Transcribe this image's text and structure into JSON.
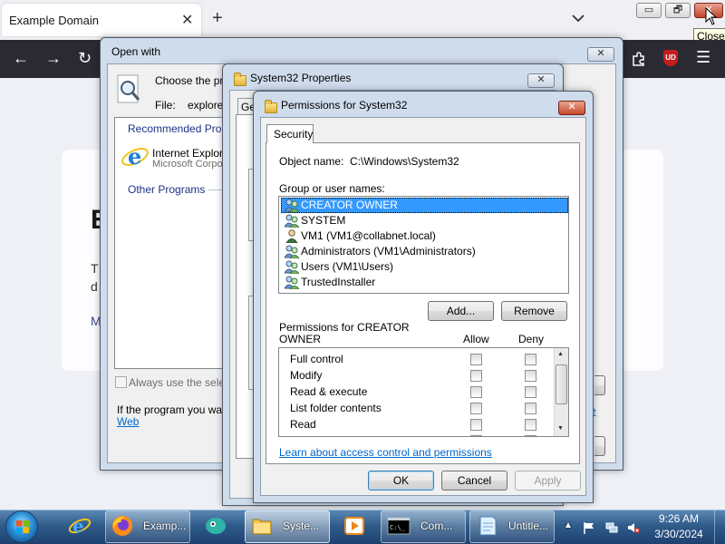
{
  "browser": {
    "tab_title": "Example Domain",
    "tab_close": "✕",
    "new_tab": "+",
    "window_controls": {
      "minimize": "▭",
      "maximize": "🗗",
      "close": "✕"
    },
    "tooltip": "Close",
    "ext_badge": "UD",
    "page_fragments": {
      "heading": "E",
      "line1": "T",
      "line2": "d",
      "line3": "M"
    }
  },
  "open_with": {
    "title": "Open with",
    "choose": "Choose the pro",
    "file_label": "File:",
    "file_value": "explore",
    "recommended": "Recommended Pro",
    "ie_name": "Internet Explore",
    "ie_publisher": "Microsoft Corpo",
    "other_programs": "Other Programs",
    "always_use": "Always use the select",
    "if_program": "If the program you want",
    "web_link": "Web",
    "right_link1": "e",
    "right_link2": "",
    "close": "✕"
  },
  "props": {
    "title": "System32 Properties",
    "tab_general": "Ge",
    "close": "✕"
  },
  "perm": {
    "title": "Permissions for System32",
    "close": "✕",
    "tab_security": "Security",
    "object_label": "Object name:",
    "object_value": "C:\\Windows\\System32",
    "group_label": "Group or user names:",
    "principals": [
      {
        "name": "CREATOR OWNER",
        "selected": true
      },
      {
        "name": "SYSTEM",
        "selected": false
      },
      {
        "name": "VM1 (VM1@collabnet.local)",
        "selected": false
      },
      {
        "name": "Administrators (VM1\\Administrators)",
        "selected": false
      },
      {
        "name": "Users (VM1\\Users)",
        "selected": false
      },
      {
        "name": "TrustedInstaller",
        "selected": false
      }
    ],
    "add_button": "Add...",
    "remove_button": "Remove",
    "perms_for": "Permissions for CREATOR",
    "perms_for2": "OWNER",
    "allow_header": "Allow",
    "deny_header": "Deny",
    "permissions": [
      {
        "name": "Full control"
      },
      {
        "name": "Modify"
      },
      {
        "name": "Read & execute"
      },
      {
        "name": "List folder contents"
      },
      {
        "name": "Read"
      },
      {
        "name": ""
      }
    ],
    "learn_link": "Learn about access control and permissions",
    "ok_button": "OK",
    "cancel_button": "Cancel",
    "apply_button": "Apply"
  },
  "taskbar": {
    "items": [
      {
        "label": "Examp..."
      },
      {
        "label": "Syste..."
      },
      {
        "label": "Com..."
      },
      {
        "label": "Untitle..."
      }
    ],
    "time": "9:26 AM",
    "date": "3/30/2024",
    "tray_arrow": "▲"
  },
  "colors": {
    "selection": "#3399ff",
    "taskbar": "#2f5b8a",
    "close_red": "#c7472c",
    "link": "#0066cc"
  }
}
